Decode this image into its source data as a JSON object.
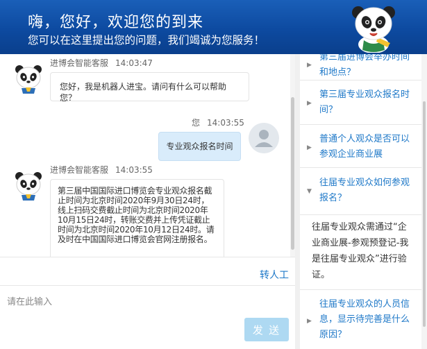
{
  "header": {
    "title": "嗨，您好，欢迎您的到来",
    "subtitle": "您可以在这里提出您的问题，我们竭诚为您服务！"
  },
  "messages": [
    {
      "sender": "进博会智能客服",
      "time": "14:03:47",
      "text": "您好，我是机器人进宝。请问有什么可以帮助您？"
    },
    {
      "sender": "您",
      "time": "14:03:55",
      "text": "专业观众报名时间"
    },
    {
      "sender": "进博会智能客服",
      "time": "14:03:55",
      "text": "第三届中国国际进口博览会专业观众报名截止时间为北京时间2020年9月30日24时，线上扫码交费截止时间为北京时间2020年10月15日24时，转账交费并上传凭证截止时间为北京时间2020年10月12日24时。请及时在中国国际进口博览会官网注册报名。"
    }
  ],
  "input": {
    "transfer_label": "转人工",
    "placeholder": "请在此输入",
    "send_label": "发 送"
  },
  "faq": {
    "items": [
      {
        "label": "第三届进博会举办时间和地点？",
        "expanded": false
      },
      {
        "label": "第三届专业观众报名时间？",
        "expanded": false
      },
      {
        "label": "普通个人观众是否可以参观企业商业展",
        "expanded": false
      },
      {
        "label": "往届专业观众如何参观报名？",
        "expanded": true
      },
      {
        "label": "往届专业观众的人员信息，显示待完善是什么原因？",
        "expanded": false
      }
    ],
    "answer": "往届专业观众需通过“企业商业展-参观预登记-我是往届专业观众”进行验证。"
  },
  "colors": {
    "header": "#0d4aa0",
    "link": "#1e78c8",
    "send": "#aed9f2",
    "user_bubble": "#d9ecfb"
  }
}
